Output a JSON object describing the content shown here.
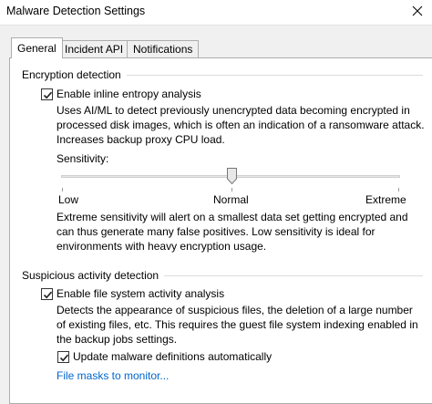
{
  "window": {
    "title": "Malware Detection Settings"
  },
  "tabs": [
    {
      "label": "General"
    },
    {
      "label": "Incident API"
    },
    {
      "label": "Notifications"
    }
  ],
  "encryption": {
    "group_title": "Encryption detection",
    "checkbox_label": "Enable inline entropy analysis",
    "checked": true,
    "description": [
      "Uses AI/ML to detect previously unencrypted data becoming encrypted in",
      "processed disk images, which is often an indication of a ransomware attack.",
      "Increases backup proxy CPU load."
    ],
    "sensitivity_label": "Sensitivity:",
    "slider": {
      "min_label": "Low",
      "mid_label": "Normal",
      "max_label": "Extreme",
      "value": "Normal"
    },
    "sensitivity_note": [
      "Extreme sensitivity will alert on a smallest data set getting encrypted and",
      "can thus generate many false positives. Low sensitivity is ideal for",
      "environments with heavy encryption usage."
    ]
  },
  "suspicious": {
    "group_title": "Suspicious activity detection",
    "checkbox_label": "Enable file system activity analysis",
    "checked": true,
    "description": [
      "Detects the appearance of suspicious files, the deletion of a large number",
      "of existing files, etc. This requires the guest file system indexing enabled in",
      "the backup jobs settings."
    ],
    "update_label": "Update malware definitions automatically",
    "update_checked": true,
    "file_masks_link": "File masks to monitor..."
  },
  "colors": {
    "link": "#0066cc",
    "border": "#adadad"
  }
}
